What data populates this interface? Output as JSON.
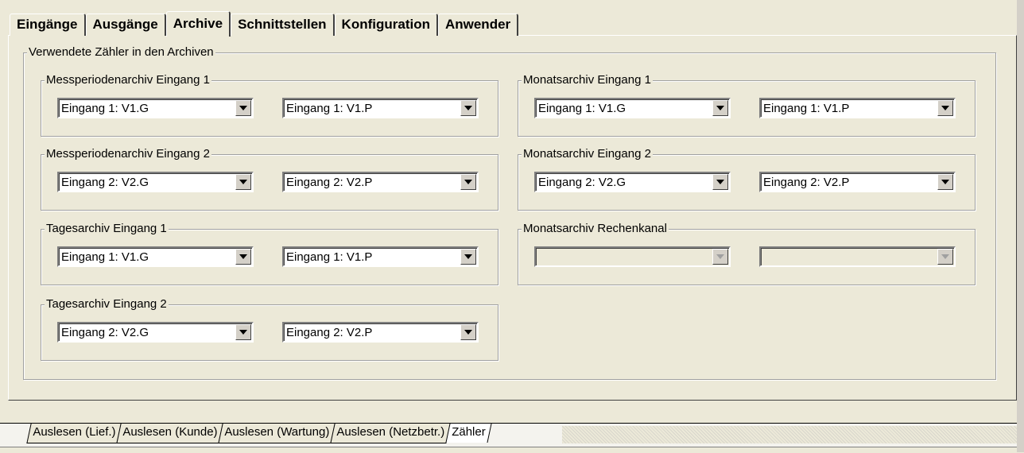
{
  "tabs": [
    "Eingänge",
    "Ausgänge",
    "Archive",
    "Schnittstellen",
    "Konfiguration",
    "Anwender"
  ],
  "active_tab": "Archive",
  "outer_group": {
    "title": "Verwendete Zähler in den Archiven"
  },
  "groups": {
    "mp1": {
      "title": "Messperiodenarchiv Eingang 1",
      "left": "Eingang 1: V1.G",
      "right": "Eingang 1: V1.P"
    },
    "mp2": {
      "title": "Messperiodenarchiv Eingang 2",
      "left": "Eingang 2: V2.G",
      "right": "Eingang 2: V2.P"
    },
    "ta1": {
      "title": "Tagesarchiv Eingang 1",
      "left": "Eingang 1: V1.G",
      "right": "Eingang 1: V1.P"
    },
    "ta2": {
      "title": "Tagesarchiv Eingang 2",
      "left": "Eingang 2: V2.G",
      "right": "Eingang 2: V2.P"
    },
    "mo1": {
      "title": "Monatsarchiv Eingang 1",
      "left": "Eingang 1: V1.G",
      "right": "Eingang 1: V1.P"
    },
    "mo2": {
      "title": "Monatsarchiv Eingang 2",
      "left": "Eingang 2: V2.G",
      "right": "Eingang 2: V2.P"
    },
    "morc": {
      "title": "Monatsarchiv Rechenkanal",
      "left": "",
      "right": ""
    }
  },
  "sheet_tabs": [
    "Auslesen (Lief.)",
    "Auslesen (Kunde)",
    "Auslesen (Wartung)",
    "Auslesen (Netzbetr.)",
    "Zähler"
  ],
  "active_sheet": "Zähler"
}
